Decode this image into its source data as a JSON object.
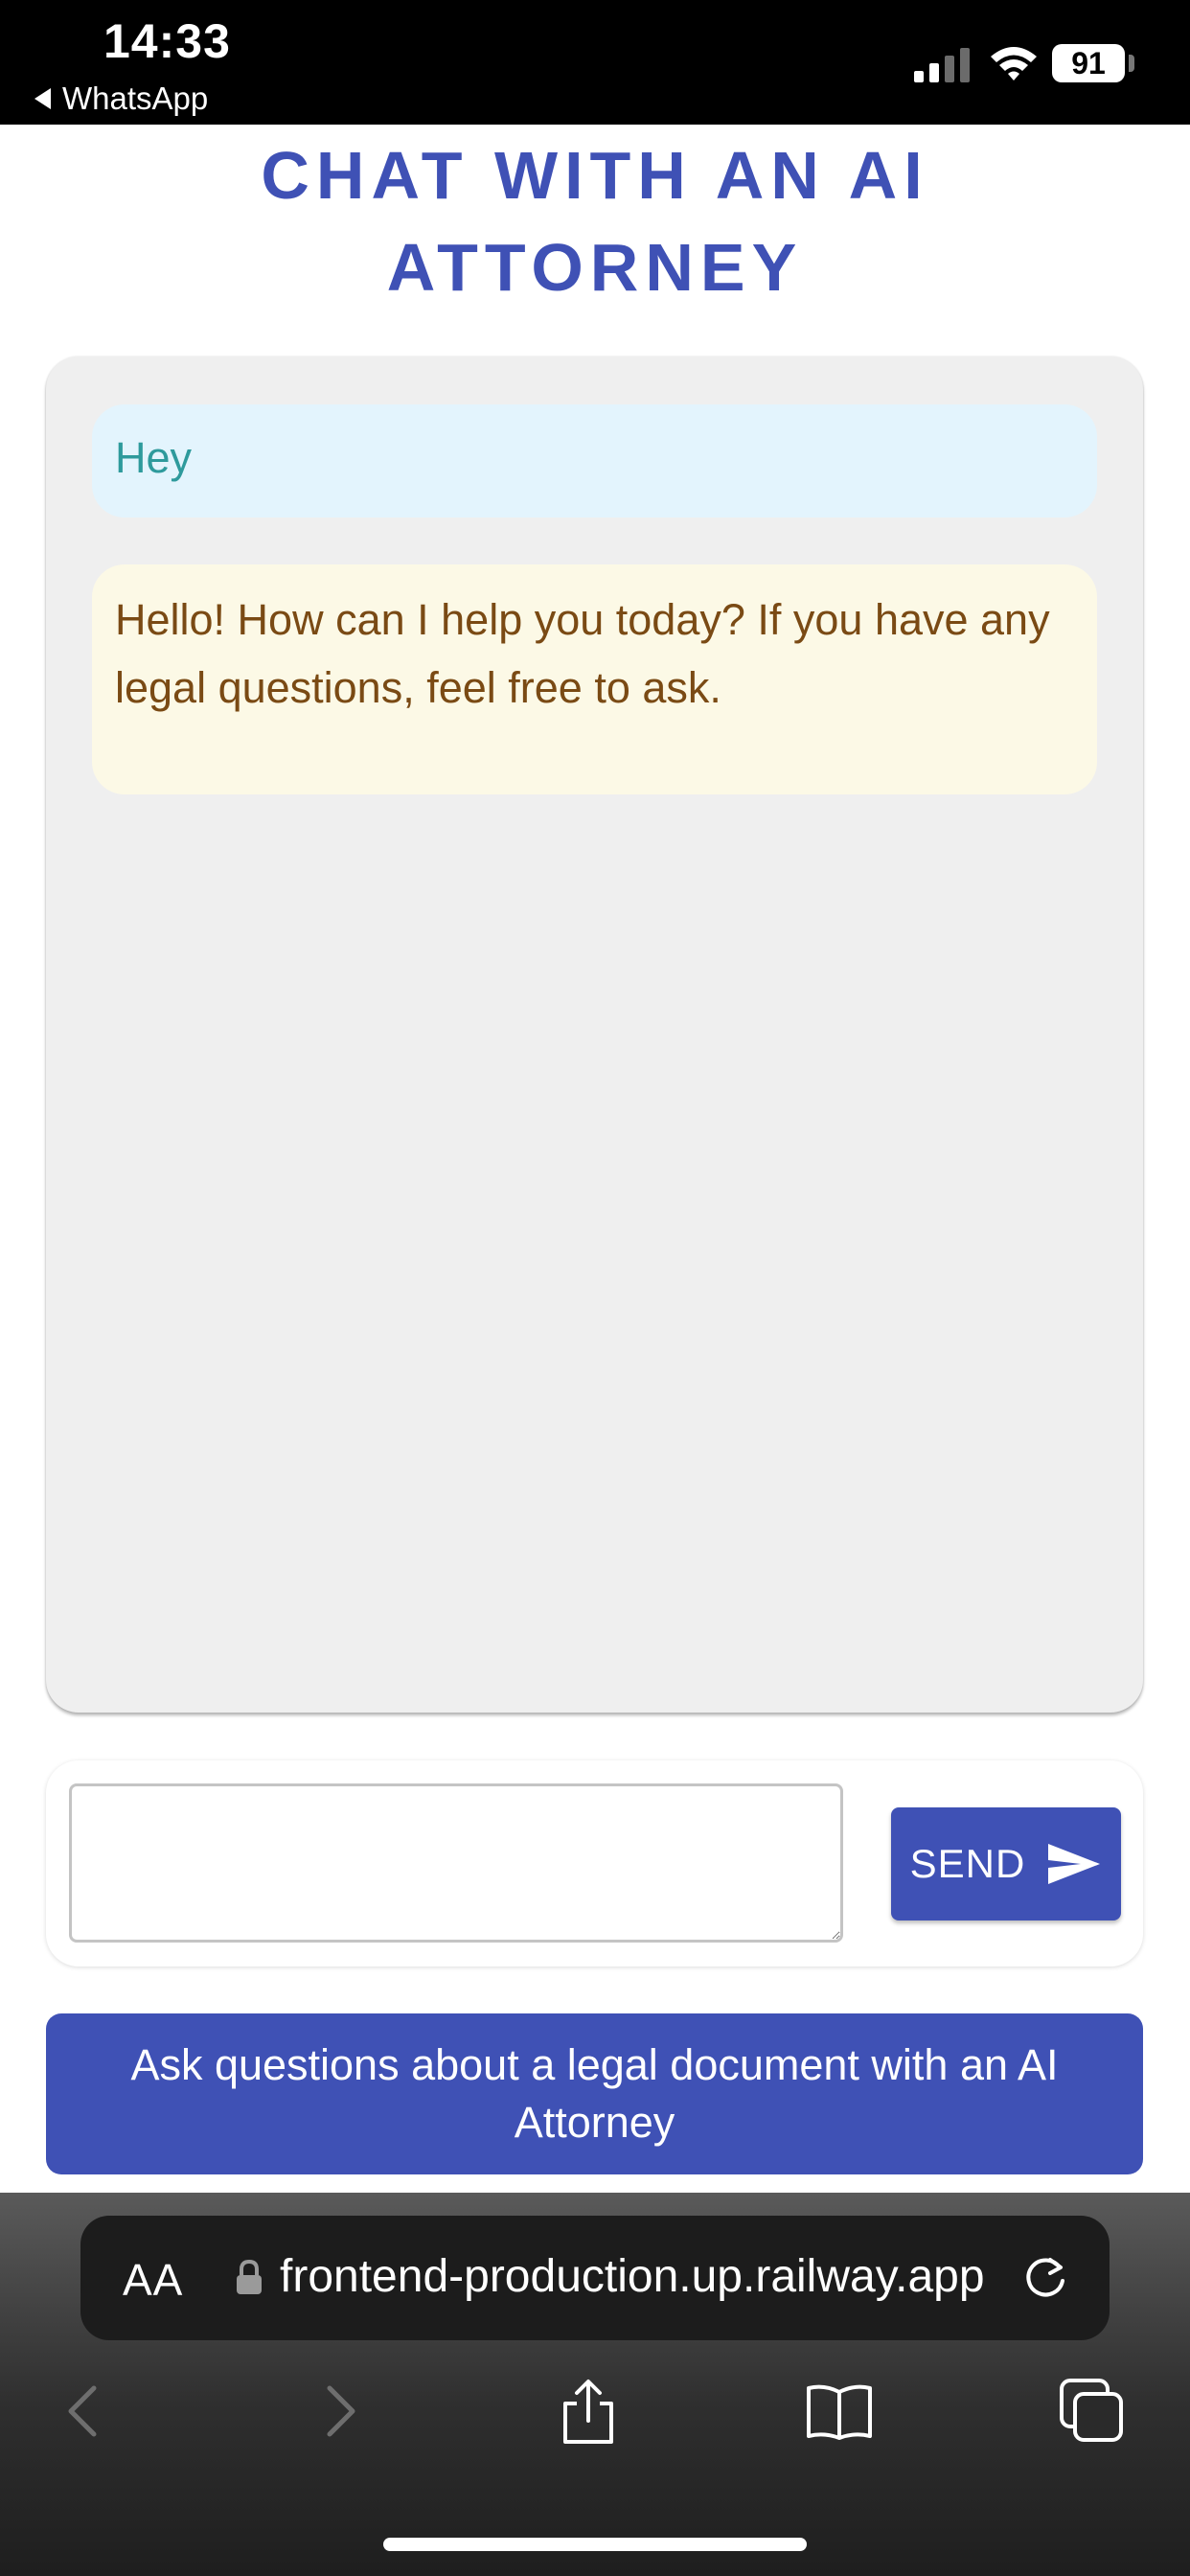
{
  "status_bar": {
    "time": "14:33",
    "back_label": "WhatsApp",
    "battery": "91",
    "icons": [
      "signal-icon",
      "wifi-icon",
      "battery-icon"
    ]
  },
  "header": {
    "title": "CHAT WITH AN AI\nATTORNEY"
  },
  "chat": {
    "messages": [
      {
        "role": "user",
        "text": "Hey"
      },
      {
        "role": "assistant",
        "text": "Hello! How can I help you today? If you have any legal questions, feel free to ask."
      }
    ]
  },
  "composer": {
    "input_value": "",
    "send_label": "SEND",
    "send_icon": "send-icon"
  },
  "doc_link": {
    "label": "Ask questions about a legal document with an AI Attorney"
  },
  "browser": {
    "aa_label": "AA",
    "url": "frontend-production.up.railway.app",
    "toolbar_icons": [
      "back-icon",
      "forward-icon",
      "share-icon",
      "bookmarks-icon",
      "tabs-icon"
    ]
  },
  "colors": {
    "primary": "#3f51b5",
    "user_bubble_bg": "#e3f4fd",
    "user_bubble_text": "#2e9a9c",
    "ai_bubble_bg": "#fcf9e6",
    "ai_bubble_text": "#7a4a14",
    "panel_bg": "#efefef"
  }
}
